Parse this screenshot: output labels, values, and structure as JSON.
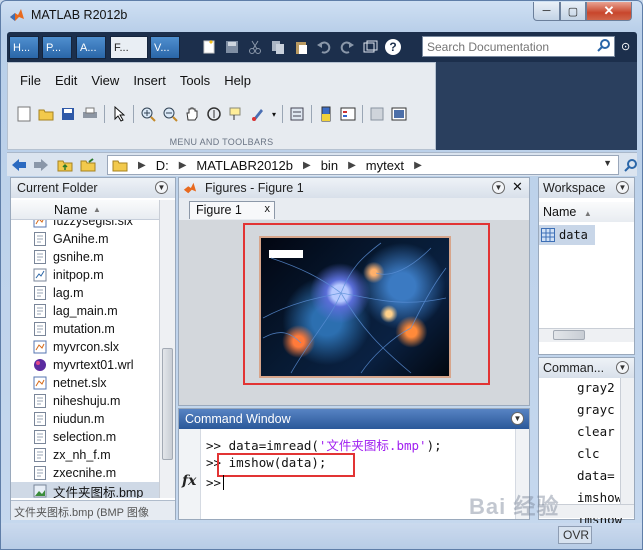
{
  "window": {
    "title": "MATLAB R2012b",
    "min": "─",
    "max": "▢",
    "close": "✕"
  },
  "tabs": [
    {
      "label": "H..."
    },
    {
      "label": "P..."
    },
    {
      "label": "A..."
    },
    {
      "label": "F..."
    },
    {
      "label": "V..."
    }
  ],
  "search": {
    "placeholder": "Search Documentation"
  },
  "menubar": [
    "File",
    "Edit",
    "View",
    "Insert",
    "Tools",
    "Help"
  ],
  "ribbon": {
    "section_label": "MENU AND TOOLBARS"
  },
  "address": {
    "path": [
      "D:",
      "MATLABR2012b",
      "bin",
      "mytext"
    ]
  },
  "current_folder": {
    "title": "Current Folder",
    "column": "Name",
    "column_sort": "▲",
    "files": [
      {
        "name": "fuzzysegisl.slx",
        "type": "slx"
      },
      {
        "name": "GAnihe.m",
        "type": "m"
      },
      {
        "name": "gsnihe.m",
        "type": "m"
      },
      {
        "name": "initpop.m",
        "type": "fig"
      },
      {
        "name": "lag.m",
        "type": "m"
      },
      {
        "name": "lag_main.m",
        "type": "m"
      },
      {
        "name": "mutation.m",
        "type": "m"
      },
      {
        "name": "myvrcon.slx",
        "type": "slx"
      },
      {
        "name": "myvrtext01.wrl",
        "type": "wrl"
      },
      {
        "name": "netnet.slx",
        "type": "slx"
      },
      {
        "name": "niheshuju.m",
        "type": "m"
      },
      {
        "name": "niudun.m",
        "type": "m"
      },
      {
        "name": "selection.m",
        "type": "m"
      },
      {
        "name": "zx_nh_f.m",
        "type": "m"
      },
      {
        "name": "zxecnihe.m",
        "type": "m"
      },
      {
        "name": "文件夹图标.bmp",
        "type": "bmp",
        "selected": true
      }
    ],
    "status": "文件夹图标.bmp (BMP 图像"
  },
  "figures": {
    "title": "Figures - Figure 1",
    "tab": "Figure 1",
    "tab_close": "x"
  },
  "command_window": {
    "title": "Command Window",
    "fx": "fx",
    "lines": [
      {
        "prompt": ">>",
        "code": "data=imread(",
        "str": "'文件夹图标.bmp'",
        "tail": ");"
      },
      {
        "prompt": ">>",
        "code": "imshow(data);"
      },
      {
        "prompt": ">>",
        "code": ""
      }
    ]
  },
  "workspace": {
    "title": "Workspace",
    "column": "Name",
    "column_sort": "▲",
    "variables": [
      {
        "name": "data"
      }
    ]
  },
  "command_history": {
    "title": "Comman...",
    "lines": [
      "gray2",
      "grayc",
      "clear",
      "clc",
      "data=",
      "imshow",
      "imshow"
    ]
  },
  "statusbar": {
    "ovr": "OVR"
  },
  "watermark": "Bai 经验"
}
